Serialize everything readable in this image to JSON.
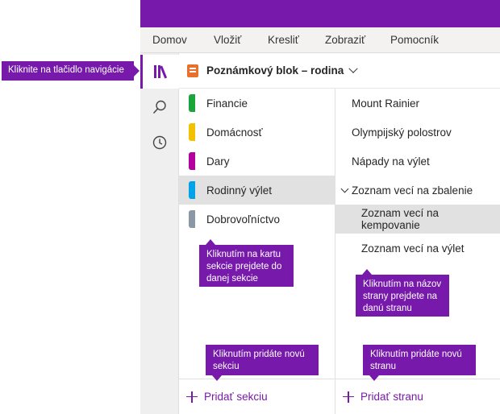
{
  "menu": {
    "items": [
      "Domov",
      "Vložiť",
      "Kresliť",
      "Zobraziť",
      "Pomocník"
    ]
  },
  "navrail": {
    "items": [
      {
        "icon": "notebooks-icon",
        "active": true
      },
      {
        "icon": "search-icon",
        "active": false
      },
      {
        "icon": "recent-clock-icon",
        "active": false
      }
    ]
  },
  "notebook": {
    "title": "Poznámkový blok – rodina",
    "icon_color": "#e8702a"
  },
  "sections": [
    {
      "label": "Financie",
      "color": "#1aa53a",
      "selected": false
    },
    {
      "label": "Domácnosť",
      "color": "#f2c200",
      "selected": false
    },
    {
      "label": "Dary",
      "color": "#b4009e",
      "selected": false
    },
    {
      "label": "Rodinný výlet",
      "color": "#00a2e8",
      "selected": true
    },
    {
      "label": "Dobrovoľníctvo",
      "color": "#8a97a5",
      "selected": false
    }
  ],
  "pages": [
    {
      "label": "Mount Rainier",
      "level": 0,
      "selected": false,
      "expanded": false
    },
    {
      "label": "Olympijský polostrov",
      "level": 0,
      "selected": false,
      "expanded": false
    },
    {
      "label": "Nápady na výlet",
      "level": 0,
      "selected": false,
      "expanded": false
    },
    {
      "label": "Zoznam vecí na zbalenie",
      "level": 0,
      "selected": false,
      "expanded": true
    },
    {
      "label": "Zoznam vecí na kempovanie",
      "level": 1,
      "selected": true,
      "expanded": false
    },
    {
      "label": "Zoznam vecí na výlet",
      "level": 1,
      "selected": false,
      "expanded": false
    }
  ],
  "add": {
    "section_label": "Pridať sekciu",
    "page_label": "Pridať stranu"
  },
  "callouts": {
    "nav": "Kliknite na tlačidlo navigácie",
    "section_tab": "Kliknutím na kartu sekcie prejdete do danej sekcie",
    "page_name": "Kliknutím na názov strany prejdete na danú stranu",
    "add_section": "Kliknutím pridáte novú sekciu",
    "add_page": "Kliknutím pridáte novú stranu"
  },
  "colors": {
    "accent": "#7719aa",
    "selected_row": "#e1e1e1"
  }
}
